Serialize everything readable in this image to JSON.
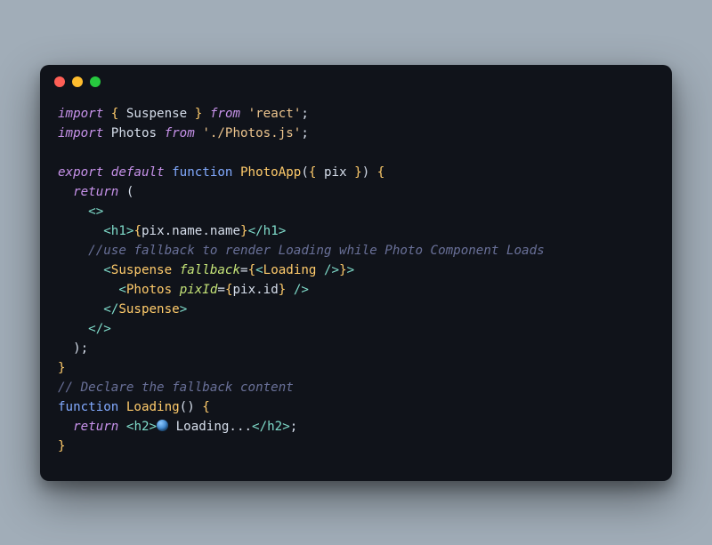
{
  "colors": {
    "bg_page": "#a1adb8",
    "bg_editor": "#10131a",
    "traffic_red": "#ff5f56",
    "traffic_yellow": "#ffbd2e",
    "traffic_green": "#27c93f",
    "keyword": "#c792ea",
    "function": "#82aaff",
    "string": "#ecc48d",
    "tag": "#7fdbca",
    "attr": "#c5e478",
    "type": "#ffcb6b",
    "comment": "#697098",
    "text": "#d6deeb"
  },
  "code": {
    "l1": {
      "import": "import",
      "lb": "{ ",
      "suspense": "Suspense",
      "rb": " }",
      "from": " from ",
      "str": "'react'",
      "semi": ";"
    },
    "l2": {
      "import": "import",
      "photos": " Photos ",
      "from": "from ",
      "str": "'./Photos.js'",
      "semi": ";"
    },
    "l3": "",
    "l4": {
      "export": "export",
      "default": " default ",
      "function": "function ",
      "name": "PhotoApp",
      "args_open": "(",
      "lb": "{ ",
      "pix": "pix",
      "rb": " }",
      "args_close": ") ",
      "brace": "{"
    },
    "l5": {
      "indent": "  ",
      "return": "return",
      "paren": " ("
    },
    "l6": {
      "indent": "    ",
      "frag": "<>"
    },
    "l7": {
      "indent": "      ",
      "open": "<",
      "h1": "h1",
      "close": ">",
      "lb": "{",
      "expr": "pix.name.name",
      "rb": "}",
      "open2": "</",
      "h1b": "h1",
      "close2": ">"
    },
    "l8": {
      "indent": "    ",
      "comment": "//use fallback to render Loading while Photo Component Loads"
    },
    "l9": {
      "indent": "      ",
      "open": "<",
      "tag": "Suspense",
      "sp": " ",
      "attr": "fallback",
      "eq": "=",
      "lb": "{",
      "open2": "<",
      "loading": "Loading",
      "slash": " />",
      "rb": "}",
      "close": ">"
    },
    "l10": {
      "indent": "        ",
      "open": "<",
      "tag": "Photos",
      "sp": " ",
      "attr": "pixId",
      "eq": "=",
      "lb": "{",
      "expr": "pix.id",
      "rb": "}",
      "slash": " />"
    },
    "l11": {
      "indent": "      ",
      "open": "</",
      "tag": "Suspense",
      "close": ">"
    },
    "l12": {
      "indent": "    ",
      "frag": "</>"
    },
    "l13": {
      "indent": "  ",
      "paren": ");"
    },
    "l14": {
      "brace": "}"
    },
    "l15": {
      "comment": "// Declare the fallback content"
    },
    "l16": {
      "function": "function ",
      "name": "Loading",
      "parens": "() ",
      "brace": "{"
    },
    "l17": {
      "indent": "  ",
      "return": "return",
      "sp": " ",
      "open": "<",
      "h2": "h2",
      "close": ">",
      "txt": " Loading...",
      "open2": "</",
      "h2b": "h2",
      "close2": ">",
      "semi": ";"
    },
    "l18": {
      "brace": "}"
    }
  }
}
